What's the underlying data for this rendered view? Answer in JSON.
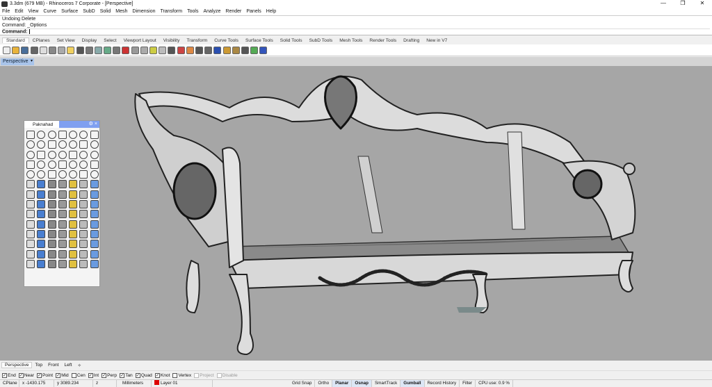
{
  "window": {
    "title": "3.3dm (679 MB) - Rhinoceros 7 Corporate - [Perspective]",
    "controls": [
      "—",
      "❐",
      "✕"
    ]
  },
  "menu": [
    "File",
    "Edit",
    "View",
    "Curve",
    "Surface",
    "SubD",
    "Solid",
    "Mesh",
    "Dimension",
    "Transform",
    "Tools",
    "Analyze",
    "Render",
    "Panels",
    "Help"
  ],
  "command": {
    "history": [
      "Undoing Delete",
      "Command: _Options"
    ],
    "prompt": "Command:",
    "value": ""
  },
  "toolbar_tabs": [
    "Standard",
    "CPlanes",
    "Set View",
    "Display",
    "Select",
    "Viewport Layout",
    "Visibility",
    "Transform",
    "Curve Tools",
    "Surface Tools",
    "Solid Tools",
    "SubD Tools",
    "Mesh Tools",
    "Render Tools",
    "Drafting",
    "New in V7"
  ],
  "viewport": {
    "title": "Perspective",
    "dropdown": "▾"
  },
  "palette": {
    "title": "Paknahad",
    "gear": "⚙",
    "close": "×"
  },
  "viewport_tabs": [
    "Perspective",
    "Top",
    "Front",
    "Left",
    "✧"
  ],
  "osnaps": [
    {
      "label": "End",
      "on": true
    },
    {
      "label": "Near",
      "on": true
    },
    {
      "label": "Point",
      "on": true
    },
    {
      "label": "Mid",
      "on": true
    },
    {
      "label": "Cen",
      "on": false
    },
    {
      "label": "Int",
      "on": true
    },
    {
      "label": "Perp",
      "on": true
    },
    {
      "label": "Tan",
      "on": true
    },
    {
      "label": "Quad",
      "on": true
    },
    {
      "label": "Knot",
      "on": true
    },
    {
      "label": "Vertex",
      "on": false
    },
    {
      "label": "Project",
      "on": false,
      "disabled": true
    },
    {
      "label": "Disable",
      "on": false,
      "disabled": true
    }
  ],
  "status": {
    "cplane": "CPlane",
    "x": "x -1430.175",
    "y": "y 3089.234",
    "z": "z",
    "units": "Millimeters",
    "layer": "Layer 01",
    "layer_color": "#dd0000",
    "toggles": [
      {
        "label": "Grid Snap",
        "on": false
      },
      {
        "label": "Ortho",
        "on": false
      },
      {
        "label": "Planar",
        "on": true
      },
      {
        "label": "Osnap",
        "on": true
      },
      {
        "label": "SmartTrack",
        "on": false
      },
      {
        "label": "Gumball",
        "on": true
      },
      {
        "label": "Record History",
        "on": false
      },
      {
        "label": "Filter",
        "on": false
      }
    ],
    "cpu": "CPU use: 0.9 %"
  }
}
